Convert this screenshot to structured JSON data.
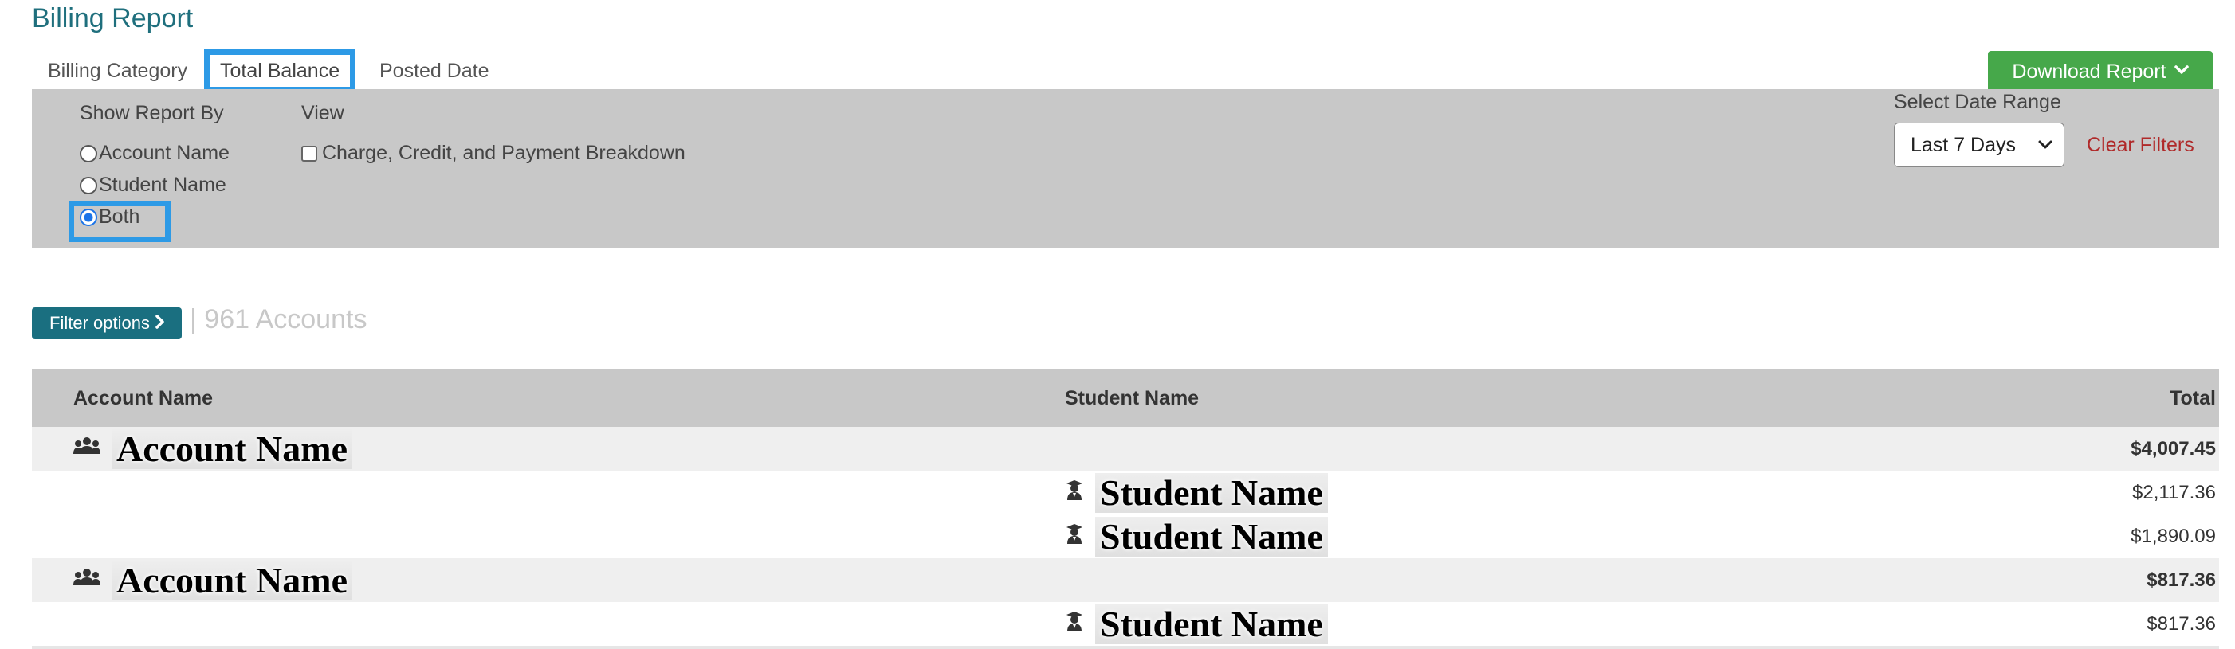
{
  "title": "Billing Report",
  "tabs": [
    {
      "label": "Billing Category",
      "active": false
    },
    {
      "label": "Total Balance",
      "active": true
    },
    {
      "label": "Posted Date",
      "active": false
    }
  ],
  "download_button": {
    "label": "Download Report",
    "icon": "chevron-down-icon",
    "color": "#46a84a"
  },
  "filters": {
    "show_report_by": {
      "label": "Show Report By",
      "options": [
        "Account Name",
        "Student Name",
        "Both"
      ],
      "selected": "Both"
    },
    "view": {
      "label": "View",
      "checkbox_label": "Charge, Credit, and Payment Breakdown",
      "checked": false
    },
    "date_range": {
      "label": "Select Date Range",
      "value": "Last 7 Days"
    },
    "clear_label": "Clear Filters"
  },
  "filter_options": {
    "label": "Filter options",
    "separator": "|",
    "count_text": "961 Accounts"
  },
  "table": {
    "headers": {
      "account": "Account Name",
      "student": "Student Name",
      "total": "Total"
    },
    "rows": [
      {
        "type": "account",
        "name": "Account Name",
        "total": "$4,007.45",
        "icon": "account-group-icon"
      },
      {
        "type": "student",
        "name": "Student Name",
        "total": "$2,117.36",
        "icon": "student-icon"
      },
      {
        "type": "student",
        "name": "Student Name",
        "total": "$1,890.09",
        "icon": "student-icon"
      },
      {
        "type": "account",
        "name": "Account Name",
        "total": "$817.36",
        "icon": "account-group-icon"
      },
      {
        "type": "student",
        "name": "Student Name",
        "total": "$817.36",
        "icon": "student-icon"
      }
    ]
  },
  "colors": {
    "title": "#1f6f7d",
    "highlight": "#2d9ae6",
    "panel": "#c8c8c8",
    "filter_button": "#1a6f80",
    "clear_filters": "#b02a2a"
  }
}
